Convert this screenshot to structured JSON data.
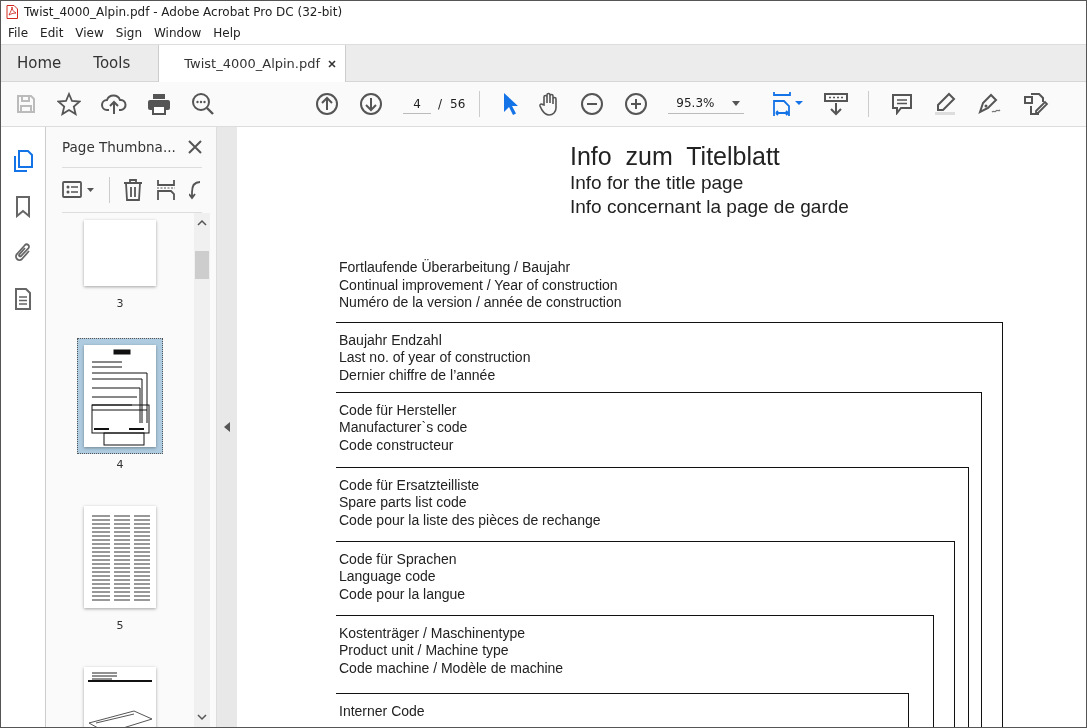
{
  "window": {
    "title": "Twist_4000_Alpin.pdf - Adobe Acrobat Pro DC (32-bit)"
  },
  "menu": [
    "File",
    "Edit",
    "View",
    "Sign",
    "Window",
    "Help"
  ],
  "tabs": [
    {
      "label": "Home",
      "selected": false
    },
    {
      "label": "Tools",
      "selected": false
    },
    {
      "label": "Twist_4000_Alpin.pdf",
      "selected": true
    }
  ],
  "toolbar": {
    "page_current": "4",
    "page_separator": "/",
    "page_total": "56",
    "zoom": "95.3%"
  },
  "rail": [
    {
      "kind": "pages",
      "selected": true
    },
    {
      "kind": "bookmarks",
      "selected": false
    },
    {
      "kind": "attachments",
      "selected": false
    },
    {
      "kind": "document",
      "selected": false
    }
  ],
  "sidebar": {
    "title": "Page Thumbna...",
    "thumbnails": [
      {
        "kind": "blank",
        "label": "3",
        "selected": false
      },
      {
        "kind": "form",
        "label": "4",
        "selected": true
      },
      {
        "kind": "list",
        "label": "5",
        "selected": false
      },
      {
        "kind": "drawing",
        "selected": false
      }
    ]
  },
  "document": {
    "title": "Info  zum  Titelblatt",
    "subtitles": [
      "Info for the title page",
      "Info concernant la page de garde"
    ],
    "header": [
      "Fortlaufende Überarbeitung / Baujahr",
      "Continual improvement / Year of construction",
      "Numéro de la version / année de construction"
    ],
    "sections": [
      [
        "Baujahr Endzahl",
        "Last no. of year of construction",
        "Dernier chiffre de l’année"
      ],
      [
        "Code für Hersteller",
        "Manufacturer`s  code",
        "Code constructeur"
      ],
      [
        "Code für Ersatzteilliste",
        "Spare parts list code",
        "Code pour la liste des pièces de rechange"
      ],
      [
        "Code für Sprachen",
        "Language code",
        "Code pour la langue"
      ],
      [
        "Kostenträger / Maschinentype",
        "Product unit / Machine type",
        "Code machine / Modèle de machine"
      ],
      [
        "Interner Code"
      ]
    ]
  }
}
